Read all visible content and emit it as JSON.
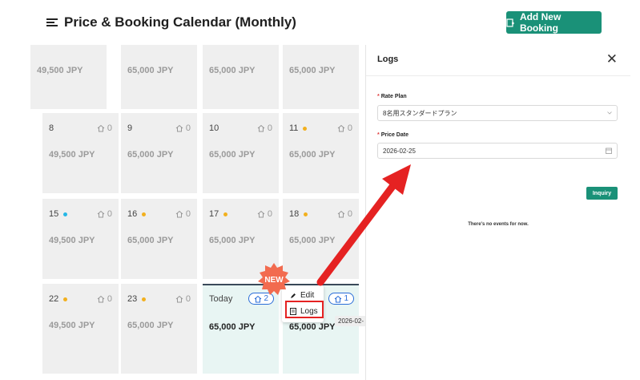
{
  "header": {
    "title": "Price & Booking Calendar (Monthly)",
    "add_button": "Add New Booking"
  },
  "calendar": {
    "cells": [
      {
        "day": "",
        "dot": "",
        "rooms": "",
        "price": "49,500 JPY"
      },
      {
        "day": "",
        "dot": "",
        "rooms": "",
        "price": "65,000 JPY"
      },
      {
        "day": "",
        "dot": "",
        "rooms": "",
        "price": "65,000 JPY"
      },
      {
        "day": "",
        "dot": "",
        "rooms": "",
        "price": "65,000 JPY"
      },
      {
        "day": "8",
        "dot": "",
        "rooms": "0",
        "price": "49,500 JPY"
      },
      {
        "day": "9",
        "dot": "",
        "rooms": "0",
        "price": "65,000 JPY"
      },
      {
        "day": "10",
        "dot": "",
        "rooms": "0",
        "price": "65,000 JPY"
      },
      {
        "day": "11",
        "dot": "#f2b01e",
        "rooms": "0",
        "price": "65,000 JPY"
      },
      {
        "day": "15",
        "dot": "#26b7e6",
        "rooms": "0",
        "price": "49,500 JPY"
      },
      {
        "day": "16",
        "dot": "#f2b01e",
        "rooms": "0",
        "price": "65,000 JPY"
      },
      {
        "day": "17",
        "dot": "#f2b01e",
        "rooms": "0",
        "price": "65,000 JPY"
      },
      {
        "day": "18",
        "dot": "#f2b01e",
        "rooms": "0",
        "price": "65,000 JPY"
      },
      {
        "day": "22",
        "dot": "#f2b01e",
        "rooms": "0",
        "price": "49,500 JPY"
      },
      {
        "day": "23",
        "dot": "#f2b01e",
        "rooms": "0",
        "price": "65,000 JPY"
      },
      {
        "day": "Today",
        "dot": "",
        "rooms": "2",
        "price": "65,000 JPY"
      },
      {
        "day": "",
        "dot": "",
        "rooms": "1",
        "price": "65,000 JPY"
      }
    ]
  },
  "context_menu": {
    "edit": "Edit",
    "logs": "Logs",
    "tooltip": "2026-02-"
  },
  "new_badge": "NEW",
  "logs_panel": {
    "title": "Logs",
    "close": "✕",
    "rate_plan_label": "Rate Plan",
    "rate_plan_value": "8名用スタンダードプラン",
    "price_date_label": "Price Date",
    "price_date_value": "2026-02-25",
    "inquiry_button": "Inquiry",
    "empty_text": "There's no events for now."
  },
  "colors": {
    "accent": "#1a9178",
    "highlight": "#e52222",
    "badge_blue": "#2b6ed8"
  },
  "icons": [
    "menu-icon",
    "add-booking-icon",
    "home-icon",
    "edit-icon",
    "logs-icon",
    "calendar-icon",
    "chevron-down-icon",
    "close-icon"
  ]
}
